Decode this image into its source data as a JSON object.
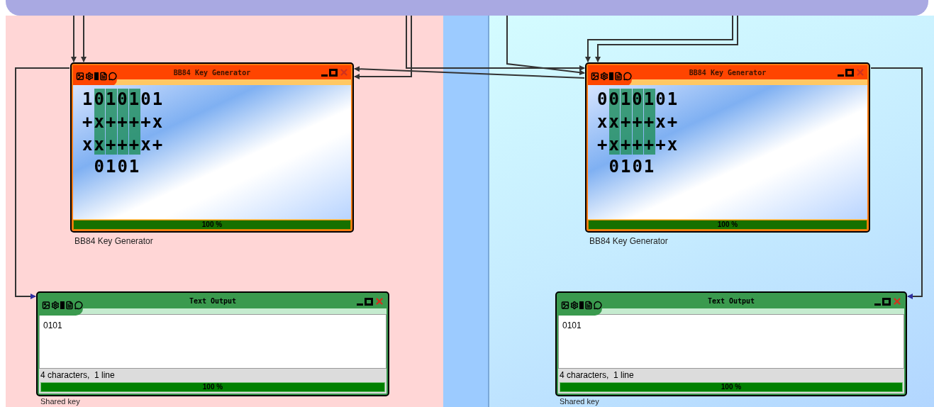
{
  "nodes": [
    {
      "kind": "generator",
      "title": "BB84 Key Generator",
      "rows": [
        "1010101",
        "+x++++x",
        "xx+++x+"
      ],
      "columns": [
        {
          "highlighted": false
        },
        {
          "highlighted": true
        },
        {
          "highlighted": true
        },
        {
          "highlighted": true
        },
        {
          "highlighted": true
        },
        {
          "highlighted": false
        },
        {
          "highlighted": false
        }
      ],
      "key": "0101",
      "progress": {
        "level": 1,
        "label": "100 %"
      },
      "caption": "BB84 Key Generator"
    },
    {
      "kind": "generator",
      "title": "BB84 Key Generator",
      "rows": [
        "0010101",
        "xx+++x+",
        "+x++++x"
      ],
      "columns": [
        {
          "highlighted": false
        },
        {
          "highlighted": true
        },
        {
          "highlighted": true
        },
        {
          "highlighted": true
        },
        {
          "highlighted": true
        },
        {
          "highlighted": false
        },
        {
          "highlighted": false
        }
      ],
      "key": "0101",
      "progress": {
        "level": 1,
        "label": "100 %"
      },
      "caption": "BB84 Key Generator"
    },
    {
      "kind": "text_output",
      "title": "Text Output",
      "text": "0101",
      "status": "4 characters,  1 line",
      "progress": {
        "level": 1,
        "label": "100 %"
      },
      "caption": "Shared key"
    },
    {
      "kind": "text_output",
      "title": "Text Output",
      "text": "0101",
      "status": "4 characters,  1 line",
      "progress": {
        "level": 1,
        "label": "100 %"
      },
      "caption": "Shared key"
    }
  ]
}
